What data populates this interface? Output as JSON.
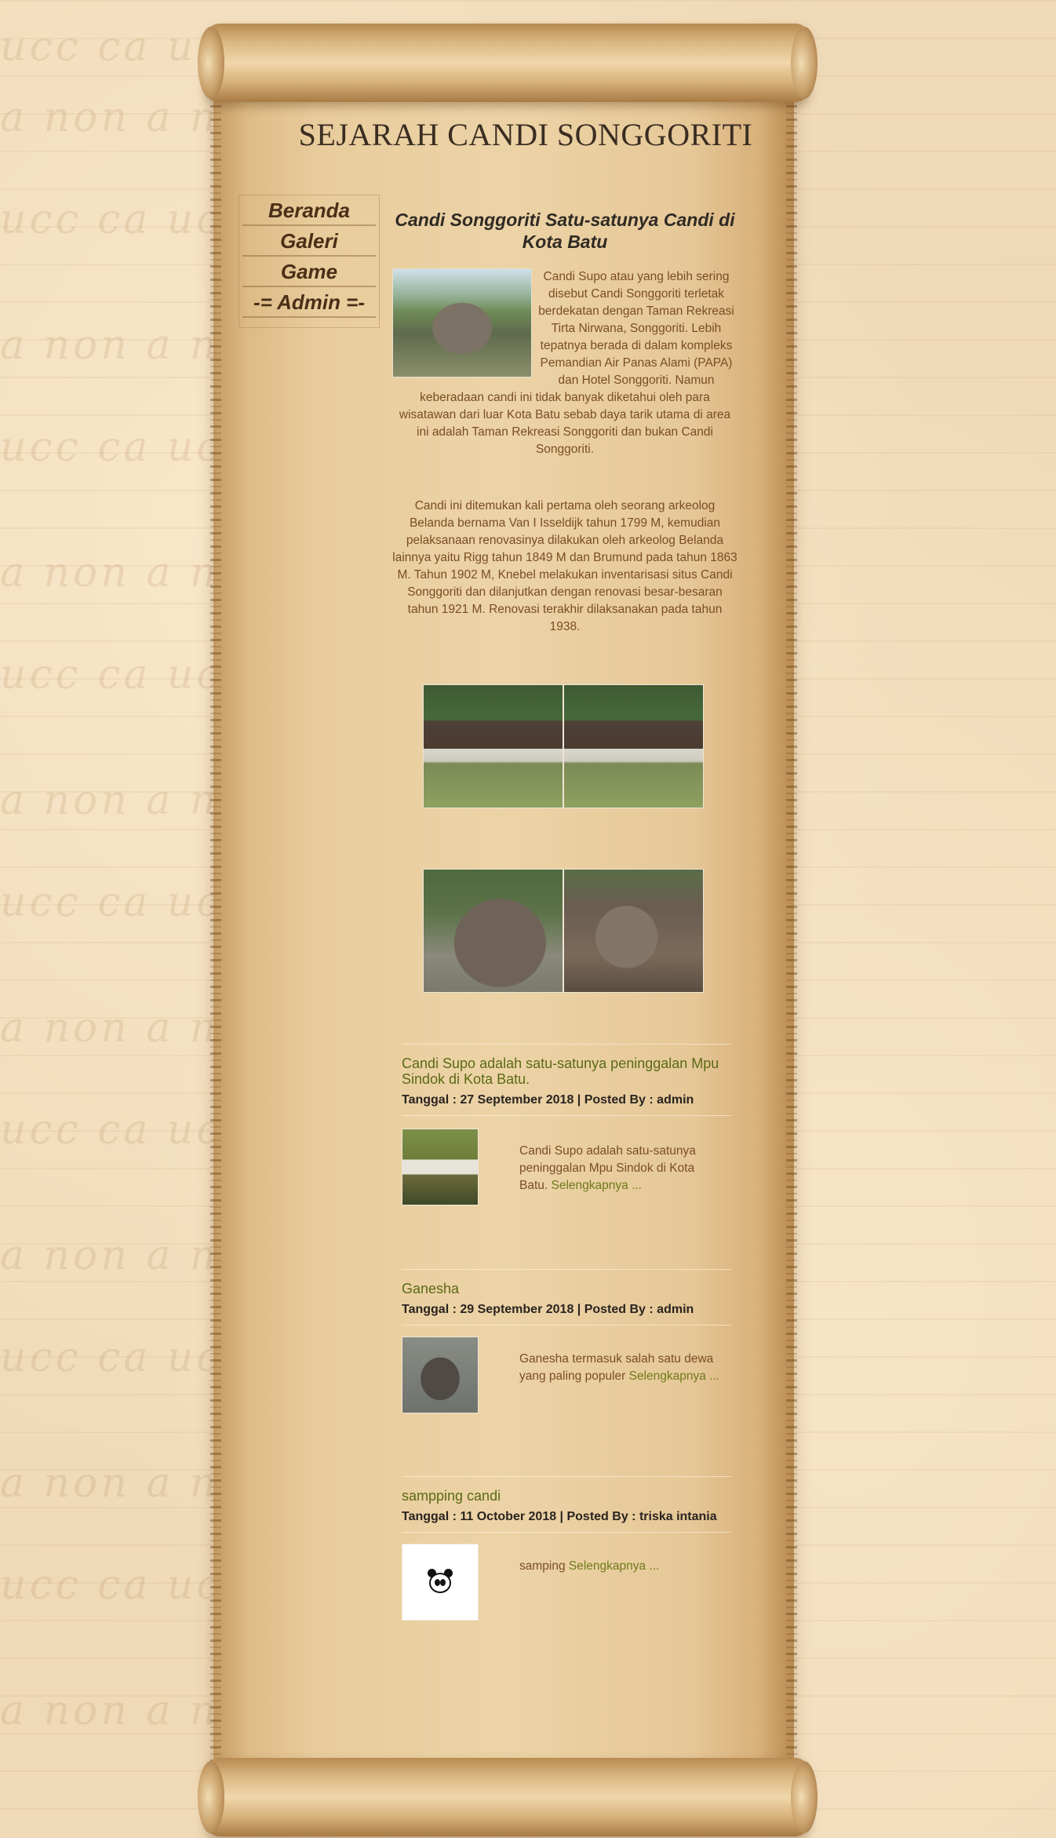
{
  "site": {
    "title": "SEJARAH CANDI SONGGORITI"
  },
  "nav": {
    "items": [
      {
        "label": "Beranda"
      },
      {
        "label": "Galeri"
      },
      {
        "label": "Game"
      },
      {
        "label": "-= Admin =-"
      }
    ]
  },
  "article": {
    "title": "Candi Songgoriti Satu-satunya Candi di Kota Batu",
    "paragraph1": "Candi Supo atau yang lebih sering disebut Candi Songgoriti terletak berdekatan dengan Taman Rekreasi Tirta Nirwana, Songgoriti. Lebih tepatnya berada di dalam kompleks Pemandian Air Panas Alami (PAPA) dan Hotel Songgoriti. Namun keberadaan candi ini tidak banyak diketahui oleh para wisatawan dari luar Kota Batu sebab daya tarik utama di area ini adalah Taman Rekreasi Songgoriti dan bukan Candi Songgoriti.",
    "paragraph2": "Candi ini ditemukan kali pertama oleh seorang arkeolog Belanda bernama Van I Isseldijk tahun 1799 M, kemudian pelaksanaan renovasinya dilakukan oleh arkeolog Belanda lainnya yaitu Rigg tahun 1849 M dan Brumund pada tahun 1863 M. Tahun 1902 M, Knebel melakukan inventarisasi situs Candi Songgoriti dan dilanjutkan dengan renovasi besar-besaran tahun 1921 M. Renovasi terakhir dilaksanakan pada tahun 1938."
  },
  "posts": [
    {
      "title": "Candi Supo adalah satu-satunya peninggalan Mpu Sindok di Kota Batu.",
      "meta": "Tanggal : 27 September 2018 | Posted By : admin",
      "excerpt": "Candi Supo adalah satu-satunya peninggalan Mpu Sindok di Kota Batu.",
      "read_more": "Selengkapnya ..."
    },
    {
      "title": "Ganesha",
      "meta": "Tanggal : 29 September 2018 | Posted By : admin",
      "excerpt": "Ganesha termasuk salah satu dewa yang paling populer",
      "read_more": "Selengkapnya ..."
    },
    {
      "title": "sampping candi",
      "meta": "Tanggal : 11 October 2018 | Posted By : triska intania",
      "excerpt": "samping",
      "read_more": "Selengkapnya ..."
    }
  ],
  "colors": {
    "nav_text": "#4a2f17",
    "body_text": "#7a4d26",
    "link": "#6f7a1c",
    "parchment": "#ecd3a6"
  }
}
